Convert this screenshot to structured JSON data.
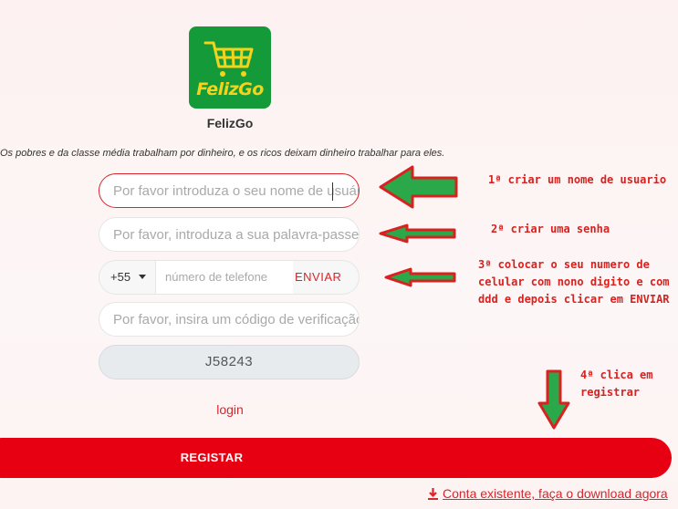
{
  "app": {
    "name": "FelizGo",
    "logo_text": "FelizGo",
    "motto": "Os pobres e da classe média trabalham por dinheiro, e os ricos deixam dinheiro trabalhar para eles."
  },
  "form": {
    "username_placeholder": "Por favor introduza o seu nome de usuário",
    "password_placeholder": "Por favor, introduza a sua palavra-passe",
    "country_code": "+55",
    "phone_placeholder": "número de telefone",
    "send_label": "ENVIAR",
    "code_placeholder": "Por favor, insira um código de verificação",
    "captcha_text": "J58243",
    "login_label": "login",
    "register_label": "REGISTAR",
    "download_label": "Conta existente, faça o download agora"
  },
  "annotations": {
    "step1": "1ª criar um nome de usuario",
    "step2": "2ª criar uma senha",
    "step3": "3ª colocar o seu numero de\ncelular com  nono digito e com\nddd e depois clicar em ENVIAR",
    "step4": "4ª clica em\nregistrar"
  },
  "colors": {
    "accent": "#e60012",
    "logo_green": "#159a3a",
    "logo_yellow": "#f5d31a",
    "arrow_green": "#2aa84a",
    "arrow_red": "#d7221f"
  },
  "icons": {
    "logo": "shopping-cart-icon",
    "country_dropdown": "caret-down-icon",
    "download": "download-icon"
  }
}
